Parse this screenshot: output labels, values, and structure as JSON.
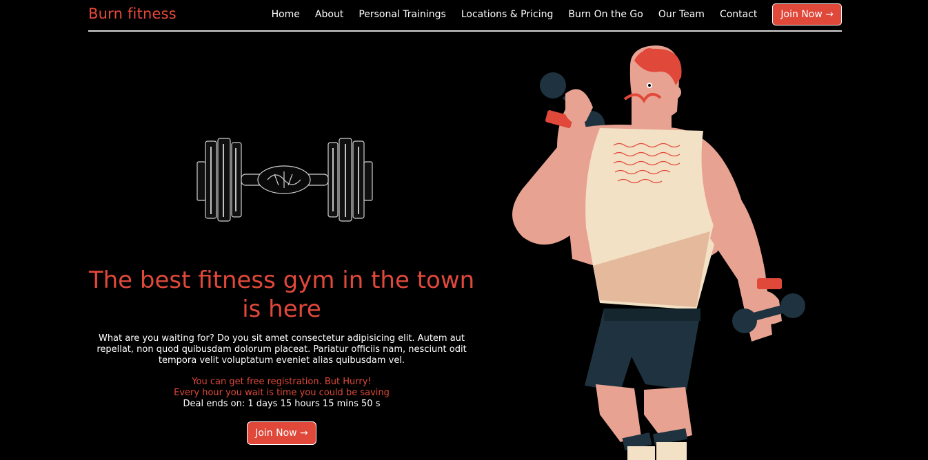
{
  "brand": {
    "name": "Burn fitness",
    "color": "#e0483a"
  },
  "nav": {
    "items": [
      {
        "label": "Home"
      },
      {
        "label": "About"
      },
      {
        "label": "Personal Trainings"
      },
      {
        "label": "Locations & Pricing"
      },
      {
        "label": "Burn On the Go"
      },
      {
        "label": "Our Team"
      },
      {
        "label": "Contact"
      }
    ],
    "cta_label": "Join Now →"
  },
  "hero": {
    "title": "The best fitness gym in the town is here",
    "description": "What are you waiting for? Do you sit amet consectetur adipisicing elit. Autem aut repellat, non quod quibusdam dolorum placeat. Pariatur officiis nam, nesciunt odit tempora velit voluptatum eveniet alias quibusdam vel.",
    "promo_line1": "You can get free registration. But Hurry!",
    "promo_line2": "Every hour you wait is time you could be saving",
    "countdown": "Deal ends on: 1 days 15 hours 15 mins 50 s",
    "cta_label": "Join Now →"
  },
  "colors": {
    "accent": "#e0483a",
    "background": "#000000",
    "skin": "#e8a292",
    "tank": "#f3e1c5",
    "shorts": "#1e333f"
  },
  "icons": {
    "hero_graphic": "dumbbell-icon",
    "illustration": "man-lifting-dumbbells"
  }
}
